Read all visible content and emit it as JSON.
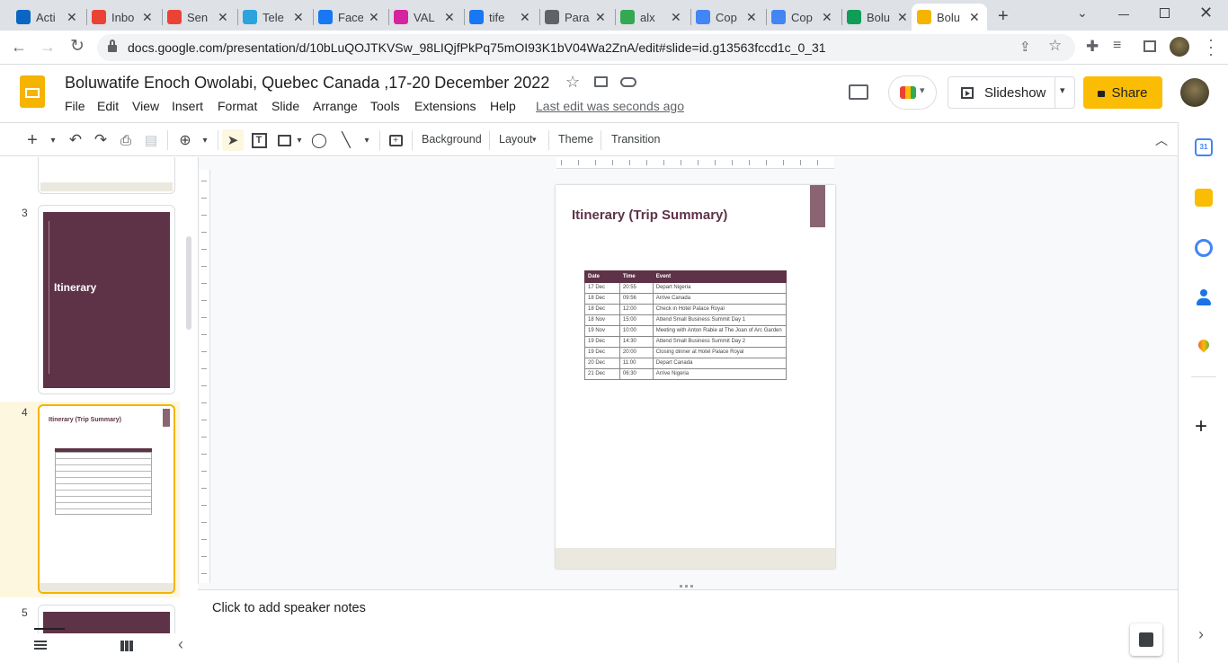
{
  "browser": {
    "tabs": [
      {
        "label": "Acti",
        "icon": "linkedin-icon",
        "color": "#0a66c2"
      },
      {
        "label": "Inbo",
        "icon": "gmail-icon",
        "color": "#ea4335"
      },
      {
        "label": "Sen",
        "icon": "gmail-icon",
        "color": "#ea4335"
      },
      {
        "label": "Tele",
        "icon": "telegram-icon",
        "color": "#2aa3de"
      },
      {
        "label": "Face",
        "icon": "facebook-icon",
        "color": "#1877f2"
      },
      {
        "label": "VAL",
        "icon": "instagram-icon",
        "color": "#d6249f"
      },
      {
        "label": "tife",
        "icon": "facebook-icon",
        "color": "#1877f2"
      },
      {
        "label": "Para",
        "icon": "quill-icon",
        "color": "#5f6368"
      },
      {
        "label": "alx",
        "icon": "drive-icon",
        "color": "#34a853"
      },
      {
        "label": "Cop",
        "icon": "docs-icon",
        "color": "#4285f4"
      },
      {
        "label": "Cop",
        "icon": "docs-icon",
        "color": "#4285f4"
      },
      {
        "label": "Bolu",
        "icon": "sheets-icon",
        "color": "#0f9d58"
      },
      {
        "label": "Bolu",
        "icon": "slides-icon",
        "color": "#f4b400",
        "active": true
      }
    ],
    "url": "docs.google.com/presentation/d/10bLuQOJTKVSw_98LIQjfPkPq75mOI93K1bV04Wa2ZnA/edit#slide=id.g13563fccd1c_0_31"
  },
  "doc": {
    "title": "Boluwatife Enoch Owolabi, Quebec Canada ,17-20 December 2022",
    "menu": [
      "File",
      "Edit",
      "View",
      "Insert",
      "Format",
      "Slide",
      "Arrange",
      "Tools",
      "Extensions",
      "Help"
    ],
    "last_edit": "Last edit was seconds ago",
    "slideshow_label": "Slideshow",
    "share_label": "Share"
  },
  "toolbar": {
    "background": "Background",
    "layout": "Layout",
    "theme": "Theme",
    "transition": "Transition"
  },
  "filmstrip": {
    "slides": [
      {
        "number": "3",
        "title": "Itinerary"
      },
      {
        "number": "4",
        "title": "Itinerary (Trip Summary)"
      },
      {
        "number": "5",
        "title": ""
      }
    ]
  },
  "slide": {
    "title": "Itinerary (Trip Summary)",
    "headers": [
      "Date",
      "Time",
      "Event"
    ],
    "rows": [
      [
        "17 Dec",
        "20:55",
        "Depart Nigeria"
      ],
      [
        "18 Dec",
        "09:56",
        "Arrive Canada"
      ],
      [
        "18 Dec",
        "12:00",
        "Check in Hotel Palace Royal"
      ],
      [
        "18 Nov",
        "15:00",
        "Attend Small Business Summit Day 1"
      ],
      [
        "19 Nov",
        "10:00",
        "Meeting with Anton Rabie at The Joan of Arc Garden"
      ],
      [
        "19 Dec",
        "14:30",
        "Attend Small Business Summit Day 2"
      ],
      [
        "19 Dec",
        "20:00",
        "Closing dinner at Hotel Palace Royal"
      ],
      [
        "20 Dec",
        "11:00",
        "Depart Canada"
      ],
      [
        "21 Dec",
        "06:30",
        "Arrive Nigeria"
      ]
    ]
  },
  "notes": {
    "placeholder": "Click to add speaker notes"
  },
  "colors": {
    "accent": "#5e3347",
    "share": "#fbbc04",
    "footer": "#ebe9df"
  }
}
